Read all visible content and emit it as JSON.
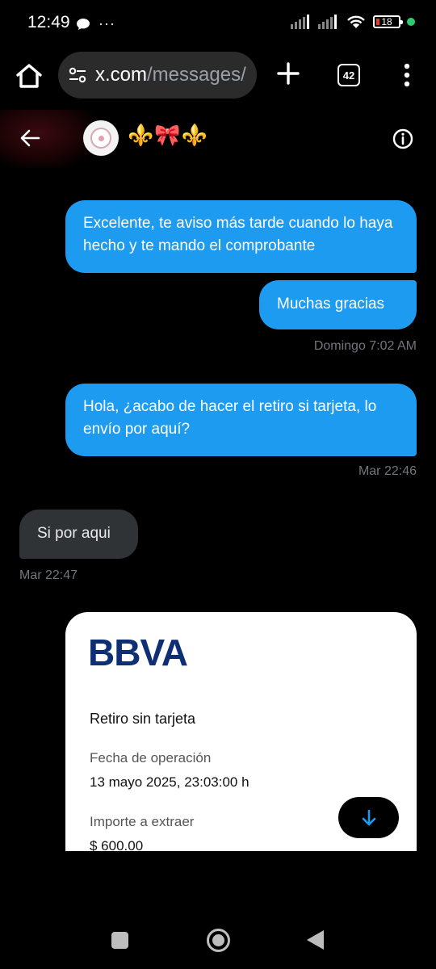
{
  "status_bar": {
    "time": "12:49",
    "more": "···",
    "battery": "18"
  },
  "browser": {
    "url_domain": "x.com",
    "url_path": "/messages/",
    "tab_count": "42"
  },
  "chat_header": {
    "contact_name": "⚜️🎀⚜️"
  },
  "messages": [
    {
      "type": "sent",
      "text": "Excelente, te aviso más tarde cuando lo haya hecho y te mando el comprobante"
    },
    {
      "type": "sent",
      "text": "Muchas gracias"
    },
    {
      "type": "timestamp",
      "text": "Domingo 7:02 AM"
    },
    {
      "type": "sent",
      "text": "Hola, ¿acabo de hacer el retiro si tarjeta, lo envío por aquí?"
    },
    {
      "type": "timestamp",
      "text": "Mar 22:46"
    },
    {
      "type": "received",
      "text": "Si por aqui"
    },
    {
      "type": "timestamp",
      "text": "Mar 22:47"
    }
  ],
  "attachment": {
    "brand": "BBVA",
    "title": "Retiro sin tarjeta",
    "label_date": "Fecha de operación",
    "value_date": "13 mayo 2025, 23:03:00 h",
    "label_amount": "Importe a extraer",
    "value_amount": "$ 600.00"
  },
  "colors": {
    "sent_bubble": "#1d9bf0",
    "received_bubble": "#2f3336",
    "bbva_blue": "#0e2f73"
  },
  "icons": [
    "home-icon",
    "site-settings-icon",
    "plus-icon",
    "more-vert-icon",
    "back-arrow-icon",
    "info-icon",
    "arrow-down-icon"
  ]
}
